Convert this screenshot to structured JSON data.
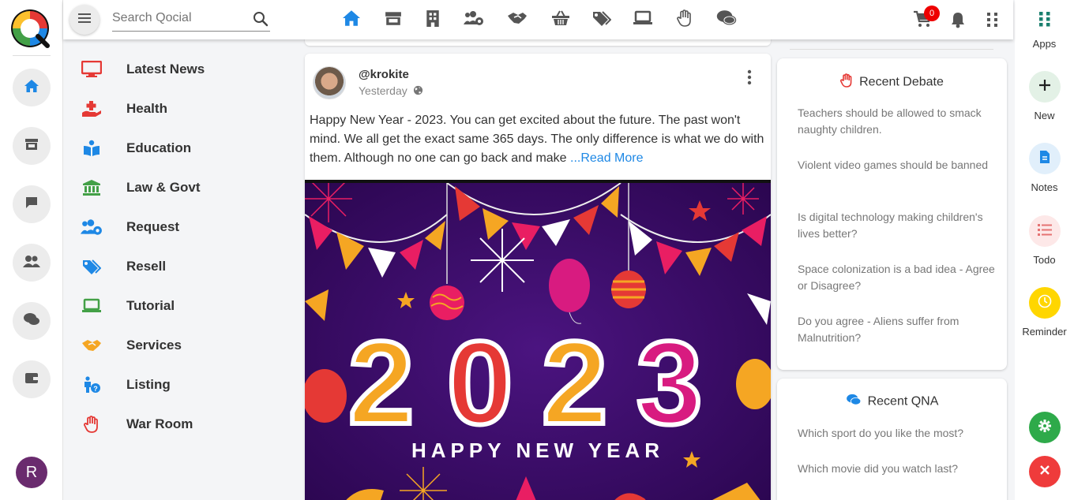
{
  "search": {
    "placeholder": "Search Qocial"
  },
  "cart": {
    "count": "0"
  },
  "categories": [
    {
      "label": "Latest News",
      "icon": "monitor-icon",
      "color": "#e53935"
    },
    {
      "label": "Health",
      "icon": "health-icon",
      "color": "#e53935"
    },
    {
      "label": "Education",
      "icon": "book-icon",
      "color": "#1e88e5"
    },
    {
      "label": "Law & Govt",
      "icon": "bank-icon",
      "color": "#43a047"
    },
    {
      "label": "Request",
      "icon": "users-gear-icon",
      "color": "#1e88e5"
    },
    {
      "label": "Resell",
      "icon": "tags-icon",
      "color": "#1e88e5"
    },
    {
      "label": "Tutorial",
      "icon": "laptop-icon",
      "color": "#43a047"
    },
    {
      "label": "Services",
      "icon": "handshake-icon",
      "color": "#f5a623"
    },
    {
      "label": "Listing",
      "icon": "person-question-icon",
      "color": "#1e88e5"
    },
    {
      "label": "War Room",
      "icon": "hand-icon",
      "color": "#e53935"
    }
  ],
  "post": {
    "username": "@krokite",
    "time": "Yesterday",
    "text": "Happy New Year - 2023. You can get excited about the future. The past won't mind. We all get the exact same 365 days. The only difference is what we do with them. Although no one can go back and make",
    "read_more": "...Read More",
    "image": {
      "year": "2023",
      "caption": "HAPPY NEW YEAR"
    }
  },
  "debate": {
    "title": "Recent Debate",
    "items": [
      "Teachers should be allowed to smack naughty children.",
      "Violent video games should be banned",
      "Is digital technology making children's lives better?",
      "Space colonization is a bad idea - Agree or Disagree?",
      "Do you agree - Aliens suffer from Malnutrition?"
    ]
  },
  "qna": {
    "title": "Recent QNA",
    "items": [
      "Which sport do you like the most?",
      "Which movie did you watch last?"
    ]
  },
  "right_rail": {
    "apps": "Apps",
    "new": "New",
    "notes": "Notes",
    "todo": "Todo",
    "reminder": "Reminder"
  },
  "user": {
    "initial": "R"
  },
  "colors": {
    "accent": "#1e88e5",
    "brand_red": "#e53935",
    "green": "#2eaa4a",
    "yellow": "#ffd600"
  }
}
